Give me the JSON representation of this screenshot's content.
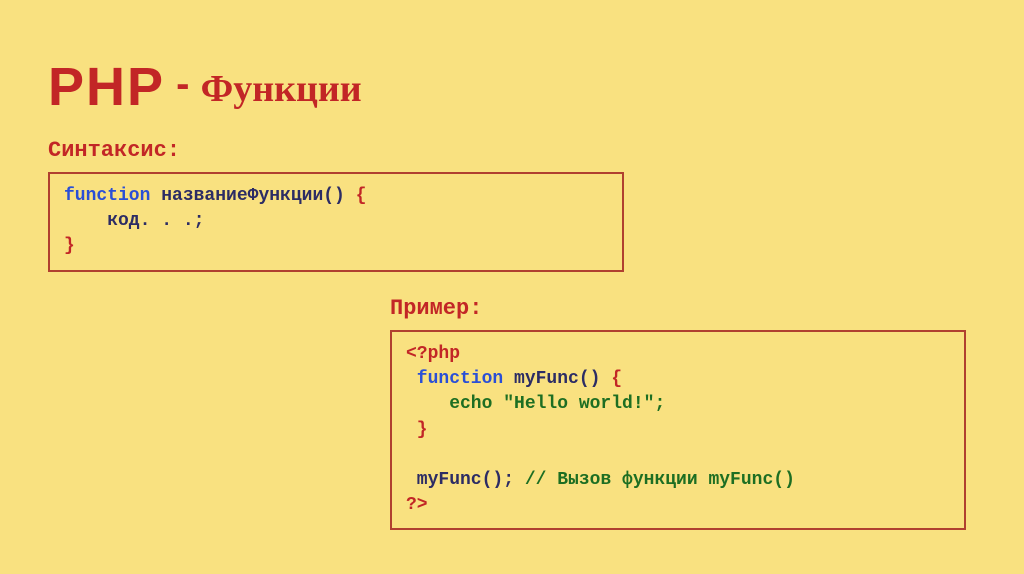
{
  "title": {
    "php": "PHP",
    "dash": " - ",
    "fn": "Функции"
  },
  "syntax_label": "Синтаксис:",
  "example_label": "Пример:",
  "code1": {
    "kw": "function",
    "name": " названиеФункции() ",
    "br_open": "{",
    "body": "    код. . .;",
    "br_close": "}"
  },
  "code2": {
    "open": "<?php",
    "kw": " function",
    "name": " myFunc() ",
    "br_open": "{",
    "echo_kw": "    echo ",
    "echo_str": "\"Hello world!\";",
    "br_close": " }",
    "blank": " ",
    "call": " myFunc(); ",
    "cmt": "// Вызов функции myFunc()",
    "close": "?>"
  }
}
